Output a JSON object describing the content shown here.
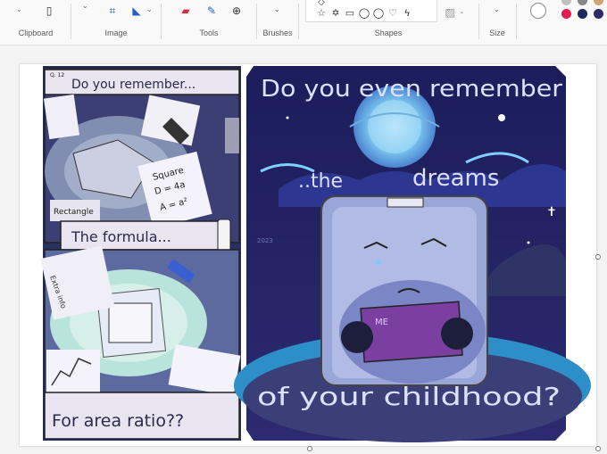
{
  "ribbon": {
    "groups": [
      {
        "id": "clipboard",
        "label": "Clipboard"
      },
      {
        "id": "image",
        "label": "Image"
      },
      {
        "id": "tools",
        "label": "Tools"
      },
      {
        "id": "brushes",
        "label": "Brushes"
      },
      {
        "id": "shapes",
        "label": "Shapes"
      },
      {
        "id": "size",
        "label": "Size"
      }
    ],
    "colors": {
      "primary": "#ffffff",
      "swatches": [
        "#e31c50",
        "#1f2a5c",
        "#2f2a6a",
        "#b8b8b8",
        "#d4a373"
      ]
    }
  },
  "artwork": {
    "comic_left": {
      "panel1_caption": "Do you remember...",
      "panel1_corner": "Q.\n12",
      "panel1_notes": [
        "Square",
        "D = 4a",
        "A = a²",
        "Rectangle"
      ],
      "panel2_caption": "The formula...",
      "panel3_caption": "For area ratio??",
      "panel3_notes": [
        "Extra info"
      ]
    },
    "comic_right": {
      "line1": "Do you even remember",
      "line2": "..the",
      "line3": "dreams",
      "line4": "of your childhood?",
      "tag": "ME",
      "signature": "2023"
    }
  }
}
